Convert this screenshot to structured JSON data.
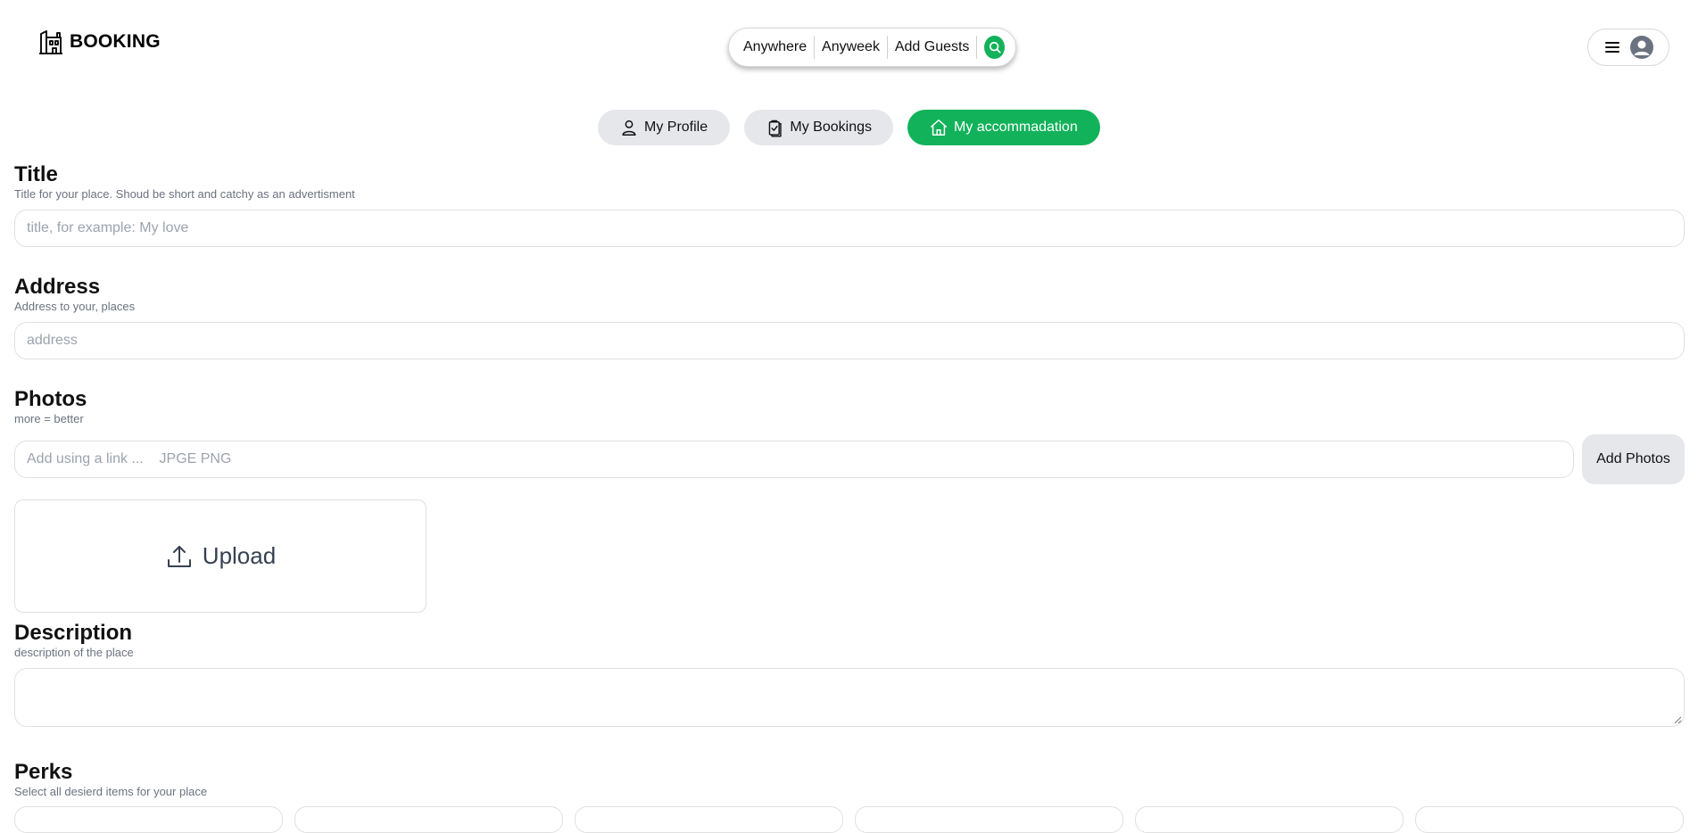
{
  "brand": {
    "name": "BOOKING",
    "icon": "building-icon"
  },
  "search": {
    "where": "Anywhere",
    "when": "Anyweek",
    "guests": "Add Guests",
    "button_icon": "search-icon",
    "accent": "#12b25a"
  },
  "user_menu": {
    "menu_icon": "hamburger-icon",
    "avatar_icon": "user-avatar-icon"
  },
  "tabs": [
    {
      "label": "My Profile",
      "icon": "user-icon",
      "active": false
    },
    {
      "label": "My Bookings",
      "icon": "clipboard-check-icon",
      "active": false
    },
    {
      "label": "My accommadation",
      "icon": "home-icon",
      "active": true
    }
  ],
  "form": {
    "title": {
      "heading": "Title",
      "hint": "Title for your place. Shoud be short and catchy as an advertisment",
      "placeholder": "title, for example: My love",
      "value": ""
    },
    "address": {
      "heading": "Address",
      "hint": "Address to your, places",
      "placeholder": "address",
      "value": ""
    },
    "photos": {
      "heading": "Photos",
      "hint": "more = better",
      "placeholder": "Add using a link ...    JPGE PNG",
      "value": "",
      "add_button": "Add Photos",
      "upload_label": "Upload",
      "upload_icon": "upload-icon"
    },
    "description": {
      "heading": "Description",
      "hint": "description of the place",
      "value": ""
    },
    "perks": {
      "heading": "Perks",
      "hint": "Select all desierd items for your place"
    }
  },
  "colors": {
    "accent": "#12b25a",
    "tab_inactive": "#e5e7eb",
    "hint_text": "#6b7280"
  }
}
